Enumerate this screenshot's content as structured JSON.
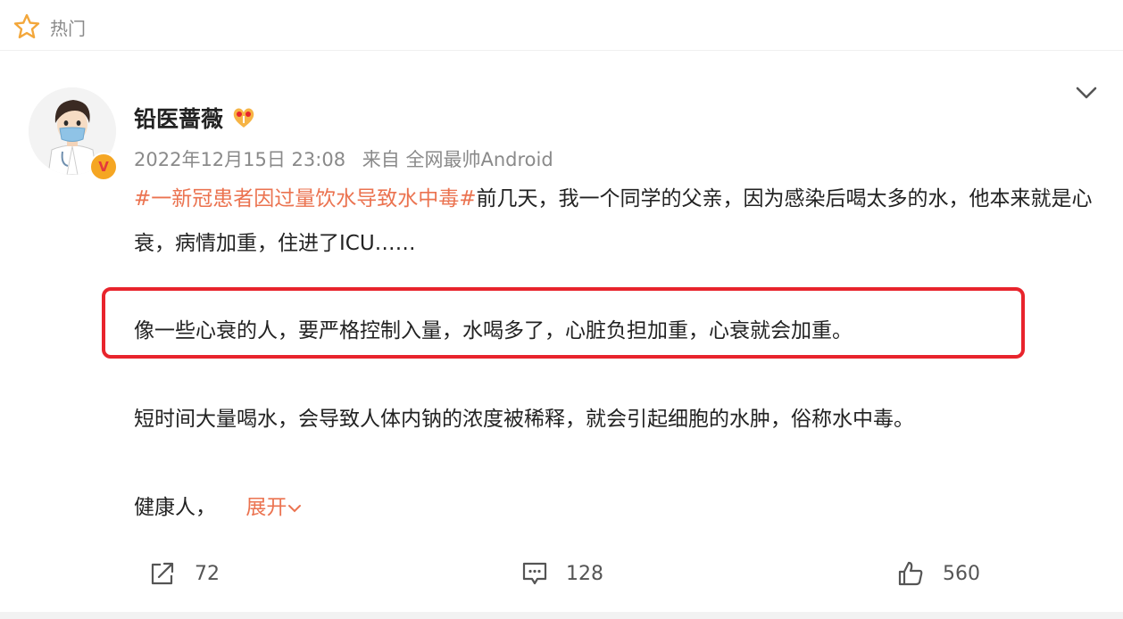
{
  "top": {
    "label": "热门"
  },
  "post": {
    "author": "铅医蔷薇",
    "timestamp": "2022年12月15日 23:08",
    "source": "来自 全网最帅Android",
    "hashtag": "#一新冠患者因过量饮水导致水中毒#",
    "p1_rest": "前几天，我一个同学的父亲，因为感染后喝太多的水，他本来就是心衰，病情加重，住进了ICU……",
    "p2": "像一些心衰的人，要严格控制入量，水喝多了，心脏负担加重，心衰就会加重。",
    "p3": "短时间大量喝水，会导致人体内钠的浓度被稀释，就会引起细胞的水肿，俗称水中毒。",
    "p4": "健康人，",
    "expand": "展开",
    "verified_badge": "V"
  },
  "actions": {
    "repost_count": "72",
    "comment_count": "128",
    "like_count": "560"
  },
  "colors": {
    "accent": "#eb7350",
    "highlight": "#e8242c",
    "badge": "#f5a623"
  },
  "icons": [
    "star-outline-icon",
    "chevron-down-icon",
    "repost-icon",
    "comment-icon",
    "like-icon",
    "level-icon"
  ]
}
